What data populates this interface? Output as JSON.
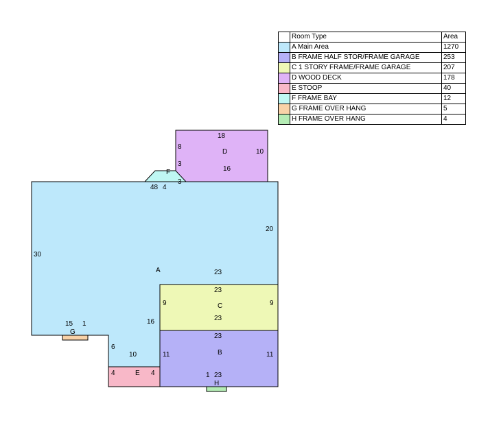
{
  "legend": {
    "header": {
      "type": "Room Type",
      "area": "Area"
    },
    "rows": [
      {
        "letter": "A",
        "type": "A Main Area",
        "area": "1270",
        "color": "#bde8fb"
      },
      {
        "letter": "B",
        "type": "B FRAME HALF STOR/FRAME GARAGE",
        "area": "253",
        "color": "#b5b1f7"
      },
      {
        "letter": "C",
        "type": "C 1 STORY FRAME/FRAME GARAGE",
        "area": "207",
        "color": "#eef8b6"
      },
      {
        "letter": "D",
        "type": "D WOOD DECK",
        "area": "178",
        "color": "#dfb3f7"
      },
      {
        "letter": "E",
        "type": "E STOOP",
        "area": "40",
        "color": "#f8b8c8"
      },
      {
        "letter": "F",
        "type": "F FRAME BAY",
        "area": "12",
        "color": "#bff7f3"
      },
      {
        "letter": "G",
        "type": "G FRAME OVER HANG",
        "area": "5",
        "color": "#f8d2a8"
      },
      {
        "letter": "H",
        "type": "H FRAME OVER HANG",
        "area": "4",
        "color": "#b5ecb5"
      }
    ]
  },
  "sketch": {
    "A": {
      "letter": "A",
      "dims": [
        "30",
        "48",
        "4",
        "20",
        "23",
        "16",
        "15",
        "1",
        "6",
        "10"
      ]
    },
    "B": {
      "letter": "B",
      "dims": [
        "23",
        "11",
        "11",
        "1",
        "23"
      ]
    },
    "C": {
      "letter": "C",
      "dims": [
        "23",
        "9",
        "9",
        "23"
      ]
    },
    "D": {
      "letter": "D",
      "dims": [
        "18",
        "8",
        "10",
        "3",
        "16",
        "3"
      ]
    },
    "E": {
      "letter": "E",
      "dims": [
        "4",
        "4"
      ]
    },
    "F": {
      "letter": "F"
    },
    "G": {
      "letter": "G"
    },
    "H": {
      "letter": "H"
    }
  }
}
